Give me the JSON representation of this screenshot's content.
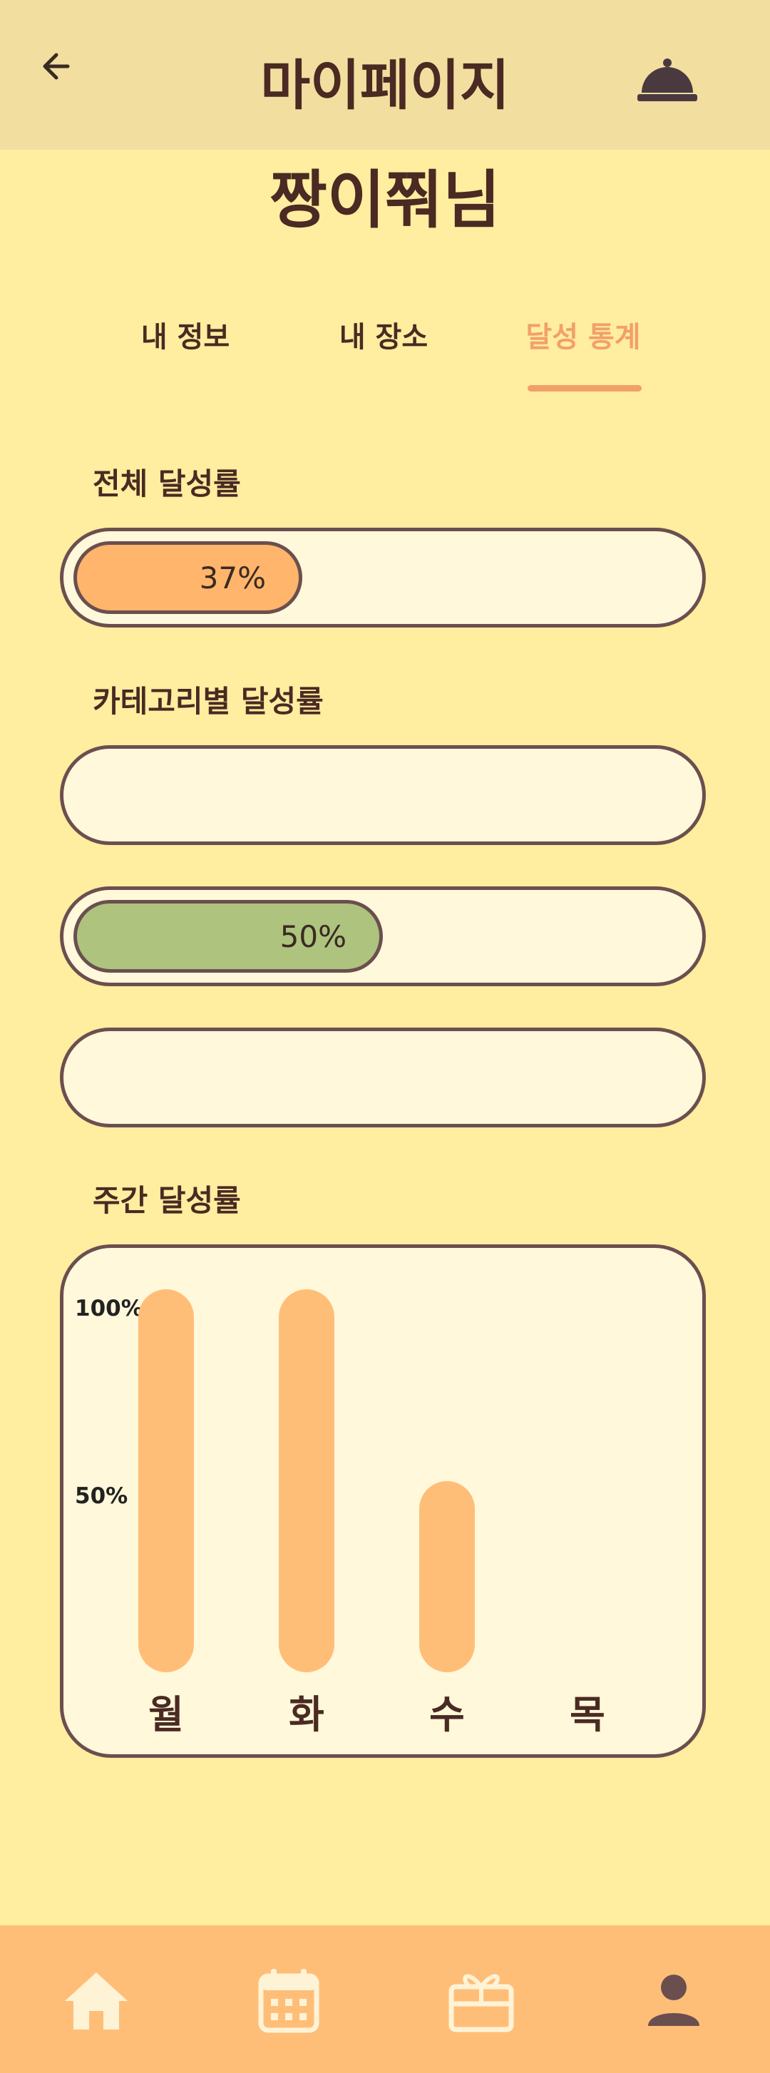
{
  "header": {
    "title": "마이페이지",
    "back_icon": "arrow-left-icon",
    "bell_icon": "service-bell-icon"
  },
  "profile": {
    "nickname": "짱이쭤님"
  },
  "tabs": [
    {
      "label": "내 정보",
      "active": false
    },
    {
      "label": "내 장소",
      "active": false
    },
    {
      "label": "달성 통계",
      "active": true
    }
  ],
  "overall": {
    "label": "전체 달성률",
    "percent": 37,
    "text": "37%",
    "color": "#FFB56B"
  },
  "category": {
    "label": "카테고리별 달성률",
    "bars": [
      {
        "percent": 0,
        "text": "",
        "color": "#FFB56B"
      },
      {
        "percent": 50,
        "text": "50%",
        "color": "#AEC37E"
      },
      {
        "percent": 0,
        "text": "",
        "color": "#FFB56B"
      }
    ]
  },
  "weekly": {
    "label": "주간 달성률",
    "chart_data": {
      "type": "bar",
      "categories": [
        "월",
        "화",
        "수",
        "목"
      ],
      "values": [
        100,
        100,
        50,
        0
      ],
      "ylim": [
        0,
        100
      ],
      "yticks": [
        "100%",
        "50%"
      ],
      "bar_color": "#FFBE78",
      "grid": false
    }
  },
  "bottom_nav": [
    {
      "icon": "home-icon"
    },
    {
      "icon": "calendar-icon"
    },
    {
      "icon": "gift-icon"
    },
    {
      "icon": "user-profile-icon"
    }
  ],
  "colors": {
    "background": "#FFEDA0",
    "header": "#F2DFA0",
    "accent": "#F2A06A",
    "nav": "#FFBE78",
    "text": "#4A2A22"
  }
}
